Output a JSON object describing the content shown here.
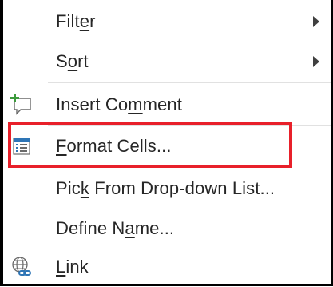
{
  "menu": {
    "items": [
      {
        "id": "filter",
        "before": "Filt",
        "mnemonic": "e",
        "after": "r",
        "submenu": true
      },
      {
        "id": "sort",
        "before": "S",
        "mnemonic": "o",
        "after": "rt",
        "submenu": true
      },
      {
        "id": "insert-comment",
        "before": "Insert Co",
        "mnemonic": "m",
        "after": "ment",
        "icon": "insert-comment-icon"
      },
      {
        "id": "format-cells",
        "before": "",
        "mnemonic": "F",
        "after": "ormat Cells...",
        "icon": "format-cells-icon",
        "highlighted": true
      },
      {
        "id": "pick-from-list",
        "before": "Pic",
        "mnemonic": "k",
        "after": " From Drop-down List..."
      },
      {
        "id": "define-name",
        "before": "Define N",
        "mnemonic": "a",
        "after": "me..."
      },
      {
        "id": "link",
        "before": "",
        "mnemonic": "L",
        "after": "ink",
        "icon": "link-icon"
      }
    ]
  },
  "colors": {
    "highlight": "#e8202a",
    "text": "#262626",
    "icon_blue": "#2e75b6",
    "icon_green": "#3c9a3c"
  }
}
